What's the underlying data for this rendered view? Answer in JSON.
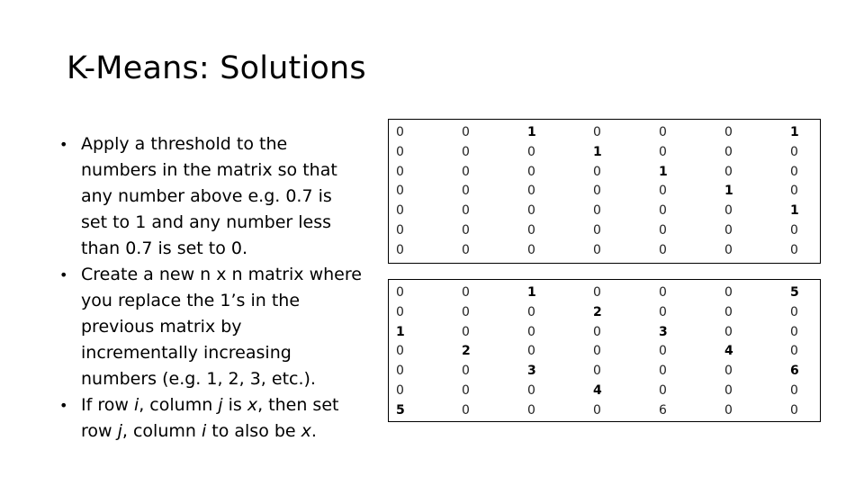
{
  "slide": {
    "title": "K-Means: Solutions",
    "bullets": [
      {
        "segments": [
          {
            "text": "Apply a threshold to the numbers in the matrix so that any number above e.g. 0.7 is set to 1 and any number less than 0.7 is set to 0.",
            "italic": false
          }
        ]
      },
      {
        "segments": [
          {
            "text": "Create a new n x n matrix where you replace the 1’s in the previous matrix by incrementally increasing numbers (e.g. 1, 2, 3, etc.).",
            "italic": false
          }
        ]
      },
      {
        "segments": [
          {
            "text": "If row ",
            "italic": false
          },
          {
            "text": "i",
            "italic": true
          },
          {
            "text": ", column ",
            "italic": false
          },
          {
            "text": "j",
            "italic": true
          },
          {
            "text": " is ",
            "italic": false
          },
          {
            "text": "x",
            "italic": true
          },
          {
            "text": ", then set row ",
            "italic": false
          },
          {
            "text": "j",
            "italic": true
          },
          {
            "text": ", column ",
            "italic": false
          },
          {
            "text": "i",
            "italic": true
          },
          {
            "text": " to also be ",
            "italic": false
          },
          {
            "text": "x",
            "italic": true
          },
          {
            "text": ".",
            "italic": false
          }
        ]
      }
    ],
    "bullet_glyph": "•"
  },
  "matrices": [
    {
      "name": "threshold-matrix",
      "rows": [
        [
          0,
          0,
          1,
          0,
          0,
          0,
          1
        ],
        [
          0,
          0,
          0,
          1,
          0,
          0,
          0
        ],
        [
          0,
          0,
          0,
          0,
          1,
          0,
          0
        ],
        [
          0,
          0,
          0,
          0,
          0,
          1,
          0
        ],
        [
          0,
          0,
          0,
          0,
          0,
          0,
          1
        ],
        [
          0,
          0,
          0,
          0,
          0,
          0,
          0
        ],
        [
          0,
          0,
          0,
          0,
          0,
          0,
          0
        ]
      ],
      "bold": [
        [
          0,
          0,
          1,
          0,
          0,
          0,
          1
        ],
        [
          0,
          0,
          0,
          1,
          0,
          0,
          0
        ],
        [
          0,
          0,
          0,
          0,
          1,
          0,
          0
        ],
        [
          0,
          0,
          0,
          0,
          0,
          1,
          0
        ],
        [
          0,
          0,
          0,
          0,
          0,
          0,
          1
        ],
        [
          0,
          0,
          0,
          0,
          0,
          0,
          0
        ],
        [
          0,
          0,
          0,
          0,
          0,
          0,
          0
        ]
      ]
    },
    {
      "name": "numbered-symmetric-matrix",
      "rows": [
        [
          0,
          0,
          1,
          0,
          0,
          0,
          5
        ],
        [
          0,
          0,
          0,
          2,
          0,
          0,
          0
        ],
        [
          1,
          0,
          0,
          0,
          3,
          0,
          0
        ],
        [
          0,
          2,
          0,
          0,
          0,
          4,
          0
        ],
        [
          0,
          0,
          3,
          0,
          0,
          0,
          6
        ],
        [
          0,
          0,
          0,
          4,
          0,
          0,
          0
        ],
        [
          5,
          0,
          0,
          0,
          6,
          0,
          0
        ]
      ],
      "bold": [
        [
          0,
          0,
          1,
          0,
          0,
          0,
          1
        ],
        [
          0,
          0,
          0,
          1,
          0,
          0,
          0
        ],
        [
          1,
          0,
          0,
          0,
          1,
          0,
          0
        ],
        [
          0,
          1,
          0,
          0,
          0,
          1,
          0
        ],
        [
          0,
          0,
          1,
          0,
          0,
          0,
          1
        ],
        [
          0,
          0,
          0,
          1,
          0,
          0,
          0
        ],
        [
          1,
          0,
          0,
          0,
          0,
          0,
          0
        ]
      ]
    }
  ]
}
